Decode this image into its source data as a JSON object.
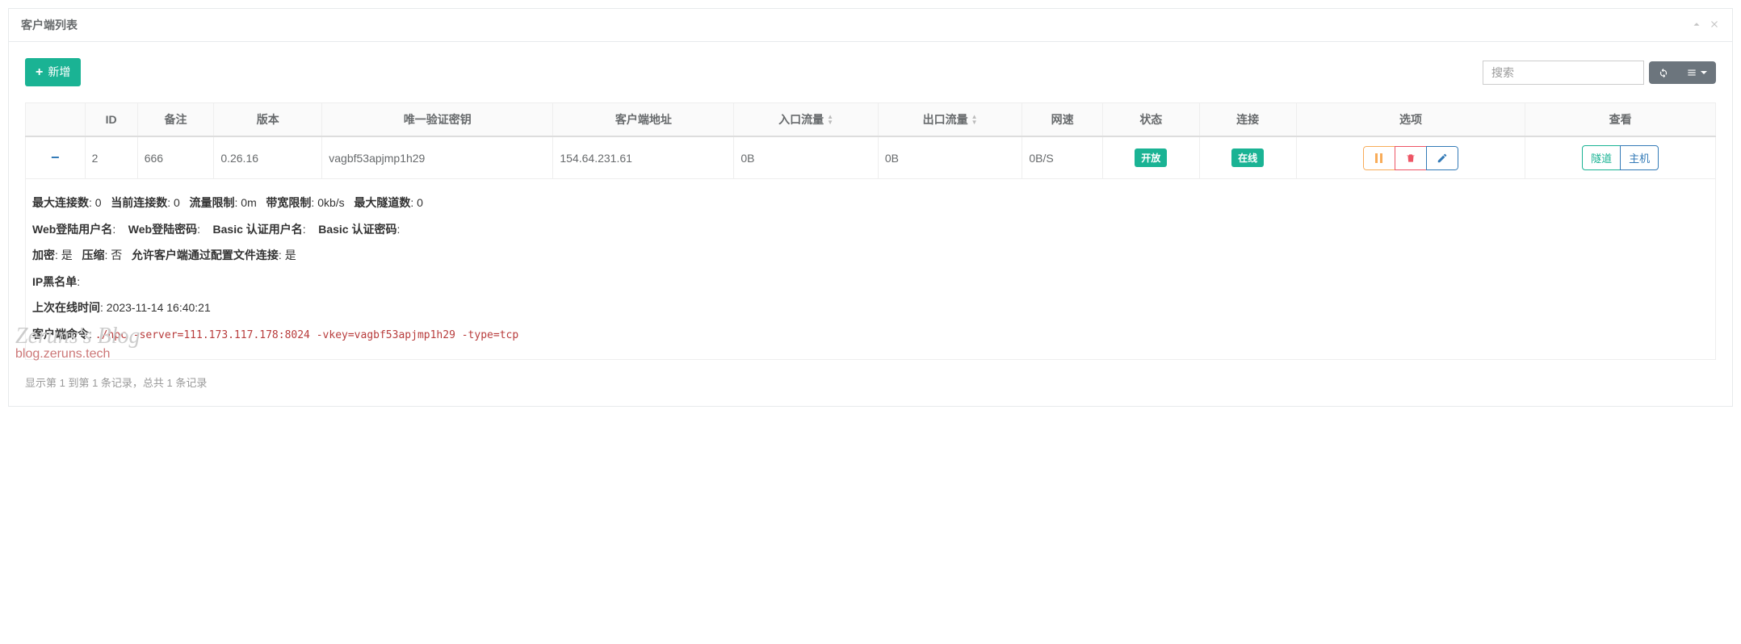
{
  "panel": {
    "title": "客户端列表"
  },
  "toolbar": {
    "add_label": "新增",
    "search_placeholder": "搜索"
  },
  "columns": {
    "expand": "",
    "id": "ID",
    "remark": "备注",
    "version": "版本",
    "vkey": "唯一验证密钥",
    "addr": "客户端地址",
    "in": "入口流量",
    "out": "出口流量",
    "speed": "网速",
    "status": "状态",
    "conn": "连接",
    "options": "选项",
    "view": "查看"
  },
  "row": {
    "id": "2",
    "remark": "666",
    "version": "0.26.16",
    "vkey": "vagbf53apjmp1h29",
    "addr": "154.64.231.61",
    "in": "0B",
    "out": "0B",
    "speed": "0B/S",
    "status": "开放",
    "conn": "在线",
    "view_tunnel": "隧道",
    "view_host": "主机"
  },
  "detail": {
    "max_conn_label": "最大连接数",
    "max_conn_val": "0",
    "cur_conn_label": "当前连接数",
    "cur_conn_val": "0",
    "flow_limit_label": "流量限制",
    "flow_limit_val": "0m",
    "bw_limit_label": "带宽限制",
    "bw_limit_val": "0kb/s",
    "max_tunnel_label": "最大隧道数",
    "max_tunnel_val": "0",
    "web_user_label": "Web登陆用户名",
    "web_user_val": "",
    "web_pass_label": "Web登陆密码",
    "web_pass_val": "",
    "basic_user_label": "Basic 认证用户名",
    "basic_user_val": "",
    "basic_pass_label": "Basic 认证密码",
    "basic_pass_val": "",
    "crypt_label": "加密",
    "crypt_val": "是",
    "compress_label": "压缩",
    "compress_val": "否",
    "allow_cfg_label": "允许客户端通过配置文件连接",
    "allow_cfg_val": "是",
    "blacklist_label": "IP黑名单",
    "blacklist_val": "",
    "last_online_label": "上次在线时间",
    "last_online_val": "2023-11-14 16:40:21",
    "cmd_label": "客户端命令",
    "cmd_val": "./npc -server=111.173.117.178:8024 -vkey=vagbf53apjmp1h29 -type=tcp"
  },
  "footer": {
    "info": "显示第 1 到第 1 条记录，总共 1 条记录"
  },
  "watermark": {
    "line1": "Zeruns's Blog",
    "line2": "blog.zeruns.tech"
  }
}
